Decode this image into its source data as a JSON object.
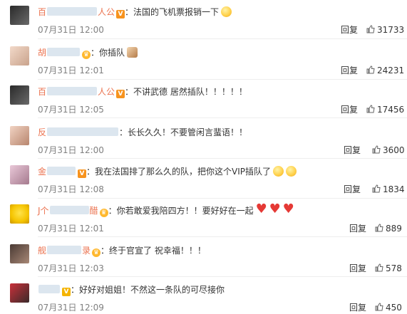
{
  "comments": [
    {
      "name_visible_start": "百",
      "name_visible_end": "人公",
      "badge": "V",
      "text": "法国的飞机票报销一下",
      "emoji": [
        "face"
      ],
      "time": "07月31日 12:00",
      "reply": "回复",
      "likes": "31733"
    },
    {
      "name_visible_start": "胡",
      "name_visible_end": "",
      "badge": "crown",
      "text": "你插队",
      "emoji": [
        "cat"
      ],
      "time": "07月31日 12:01",
      "reply": "回复",
      "likes": "24231"
    },
    {
      "name_visible_start": "百",
      "name_visible_end": "人公",
      "badge": "V",
      "text": "不讲武德 居然插队！！！！！",
      "emoji": [],
      "time": "07月31日 12:05",
      "reply": "回复",
      "likes": "17456"
    },
    {
      "name_visible_start": "反",
      "name_visible_end": "",
      "badge": "",
      "text": "长长久久！不要管闲言蜚语！！",
      "emoji": [],
      "time": "07月31日 12:00",
      "reply": "回复",
      "likes": "3600"
    },
    {
      "name_visible_start": "金",
      "name_visible_end": "",
      "badge": "V",
      "text": "我在法国排了那么久的队，把你这个VIP插队了",
      "emoji": [
        "face",
        "face"
      ],
      "time": "07月31日 12:08",
      "reply": "回复",
      "likes": "1834"
    },
    {
      "name_visible_start": "J个",
      "name_visible_end": "醋",
      "badge": "crown",
      "text": "你若敢爱我陪四方！！要好好在一起",
      "emoji": [
        "heart",
        "heart",
        "heart"
      ],
      "time": "07月31日 12:01",
      "reply": "回复",
      "likes": "889"
    },
    {
      "name_visible_start": "舰",
      "name_visible_end": "录",
      "badge": "crown",
      "text": "终于官宣了 祝幸福！！！",
      "emoji": [],
      "time": "07月31日 12:03",
      "reply": "回复",
      "likes": "578"
    },
    {
      "name_visible_start": "",
      "name_visible_end": "",
      "badge": "V2",
      "text": "好好对姐姐！不然这一条队的可尽接你",
      "emoji": [],
      "time": "07月31日 12:09",
      "reply": "回复",
      "likes": "450"
    }
  ],
  "colors": {
    "username": "#eb7350",
    "time": "#808080",
    "text": "#333333",
    "vip_badge": "#f7931e"
  },
  "icons": {
    "like": "thumbs-up-icon",
    "vip": "vip-badge-icon",
    "crown": "crown-badge-icon"
  }
}
